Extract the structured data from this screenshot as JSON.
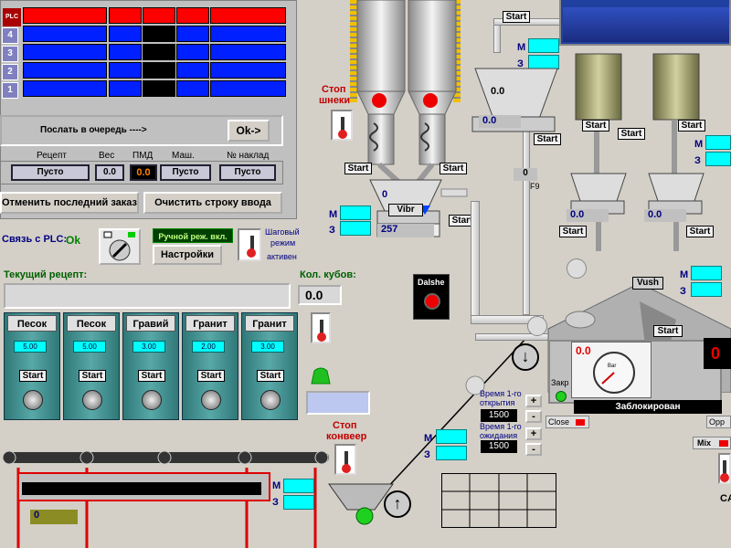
{
  "plc_table": {
    "plc_label": "PLC",
    "row_numbers": [
      "4",
      "3",
      "2",
      "1"
    ]
  },
  "queue": {
    "label": "Послать в очередь  ---->",
    "ok_button": "Ok->"
  },
  "recipe_header": {
    "recipe": "Рецепт",
    "weight": "Вес",
    "pmd": "ПМД",
    "mash": "Маш.",
    "nakl": "№ наклад"
  },
  "recipe_values": {
    "recipe": "Пусто",
    "weight": "0.0",
    "pmd": "0.0",
    "mash": "Пусто",
    "nakl": "Пусто"
  },
  "buttons": {
    "cancel_last": "Отменить последний заказ",
    "clear_input": "Очистить строку ввода",
    "settings": "Настройки"
  },
  "plc_link": {
    "label": "Связь с PLC:",
    "status": "Ok"
  },
  "manual_mode": "Ручной реж. вкл.",
  "step_mode": {
    "line1": "Шаговый",
    "line2": "режим",
    "line3": "активен"
  },
  "current_recipe_label": "Текущий рецепт:",
  "cubes": {
    "label": "Кол. кубов:",
    "value": "0.0"
  },
  "bins": [
    {
      "name": "Песок",
      "value": "5.00",
      "start": "Start"
    },
    {
      "name": "Песок",
      "value": "5.00",
      "start": "Start"
    },
    {
      "name": "Гравий",
      "value": "3.00",
      "start": "Start"
    },
    {
      "name": "Гранит",
      "value": "2.00",
      "start": "Start"
    },
    {
      "name": "Гранит",
      "value": "3.00",
      "start": "Start"
    }
  ],
  "conveyor": {
    "value": "0",
    "m": "M",
    "z": "З"
  },
  "stop_screws": {
    "line1": "Стоп",
    "line2": "шнеки"
  },
  "stop_conveyor": {
    "line1": "Стоп",
    "line2": "конвеер"
  },
  "start": "Start",
  "mz": {
    "m": "M",
    "z": "З"
  },
  "vibr": {
    "label": "Vibr",
    "value": "0",
    "reading": "257"
  },
  "water_hopper": {
    "value": "0.0",
    "readout": "0.0"
  },
  "f9": {
    "value": "0",
    "label": "F9"
  },
  "cement_readouts": [
    "0.0",
    "0.0"
  ],
  "dalshe": "Dalshe",
  "vush": "Vush",
  "mixer_panel": {
    "value": "0.0",
    "blocked": "Заблокирован",
    "gauge_label": "Bar",
    "close_label": "Close",
    "open_label": "Opp",
    "mix_label": "Mix",
    "zakr": "Закр"
  },
  "gauge_ticks": [
    "0",
    "10",
    "20",
    "30",
    "40",
    "50",
    "60",
    "70"
  ],
  "timing": {
    "open_label": "Время 1-го открытия",
    "open_value": "1500",
    "wait_label": "Время 1-го ожидания",
    "wait_value": "1500",
    "plus": "+",
    "minus": "-"
  },
  "partial_right": {
    "ca": "CA",
    "zero": "0"
  }
}
